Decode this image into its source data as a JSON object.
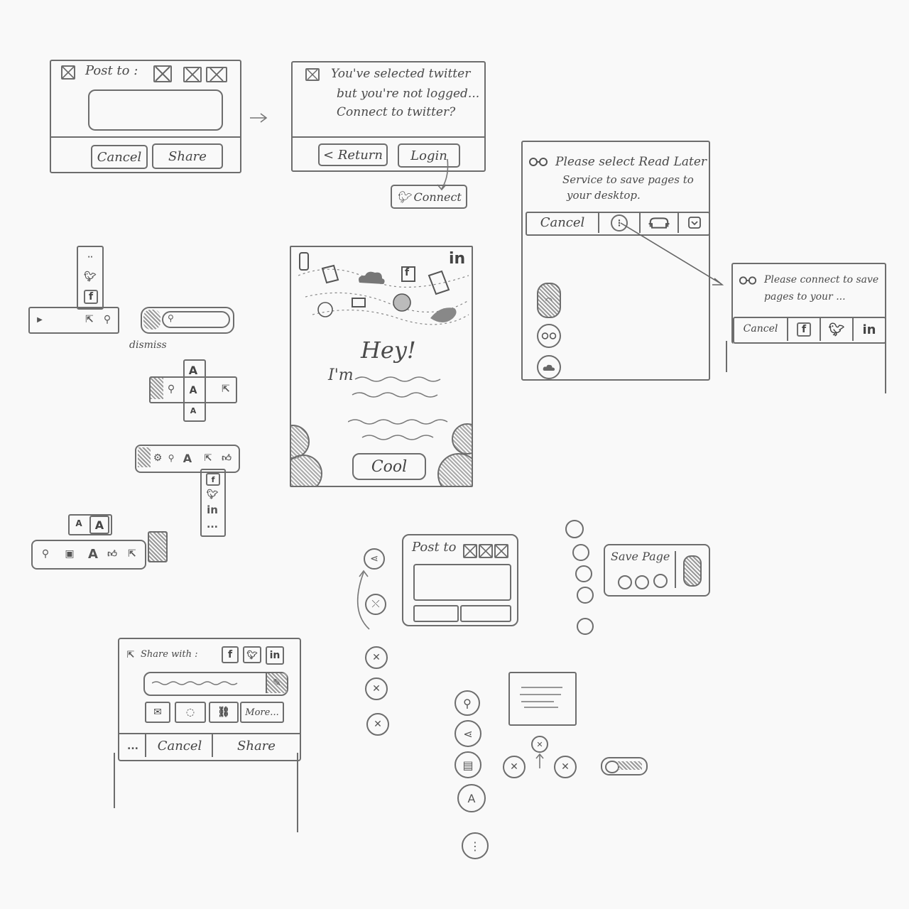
{
  "post_dialog": {
    "title": "Post to :",
    "cancel_label": "Cancel",
    "share_label": "Share"
  },
  "twitter_dialog": {
    "message_line1": "You've selected twitter",
    "message_line2": "but you're not logged...",
    "message_line3": "Connect to twitter?",
    "return_label": "< Return",
    "login_label": "Login",
    "connect_label": "Connect"
  },
  "readlater_dialog": {
    "message_line1": "Please select Read Later",
    "message_line2": "Service  to save pages to",
    "message_line3": "your desktop.",
    "cancel_label": "Cancel"
  },
  "connect_dialog": {
    "message_line1": "Please connect to save",
    "message_line2": "pages to your ...",
    "cancel_label": "Cancel",
    "facebook_label": "f",
    "linkedin_label": "in"
  },
  "toolbar_sketches": {
    "dismiss_label": "dismiss",
    "font_a_label": "A",
    "linkedin_label": "in",
    "more_label": "..."
  },
  "welcome_screen": {
    "greeting": "Hey!",
    "im_label": "I'm",
    "cool_label": "Cool",
    "linkedin_label": "in",
    "facebook_label": "f"
  },
  "popover_post": {
    "title": "Post to"
  },
  "save_page_popover": {
    "title": "Save Page"
  },
  "share_with_dialog": {
    "title": "Share with :",
    "more_label": "More...",
    "dots_label": "...",
    "cancel_label": "Cancel",
    "share_label": "Share",
    "linkedin_label": "in",
    "facebook_label": "f"
  },
  "icon_column": {
    "font_label": "A",
    "more_label": "⋮"
  },
  "colors": {
    "stroke": "#6d6d6d",
    "background": "#f9f9f9",
    "text": "#4a4a4a"
  }
}
